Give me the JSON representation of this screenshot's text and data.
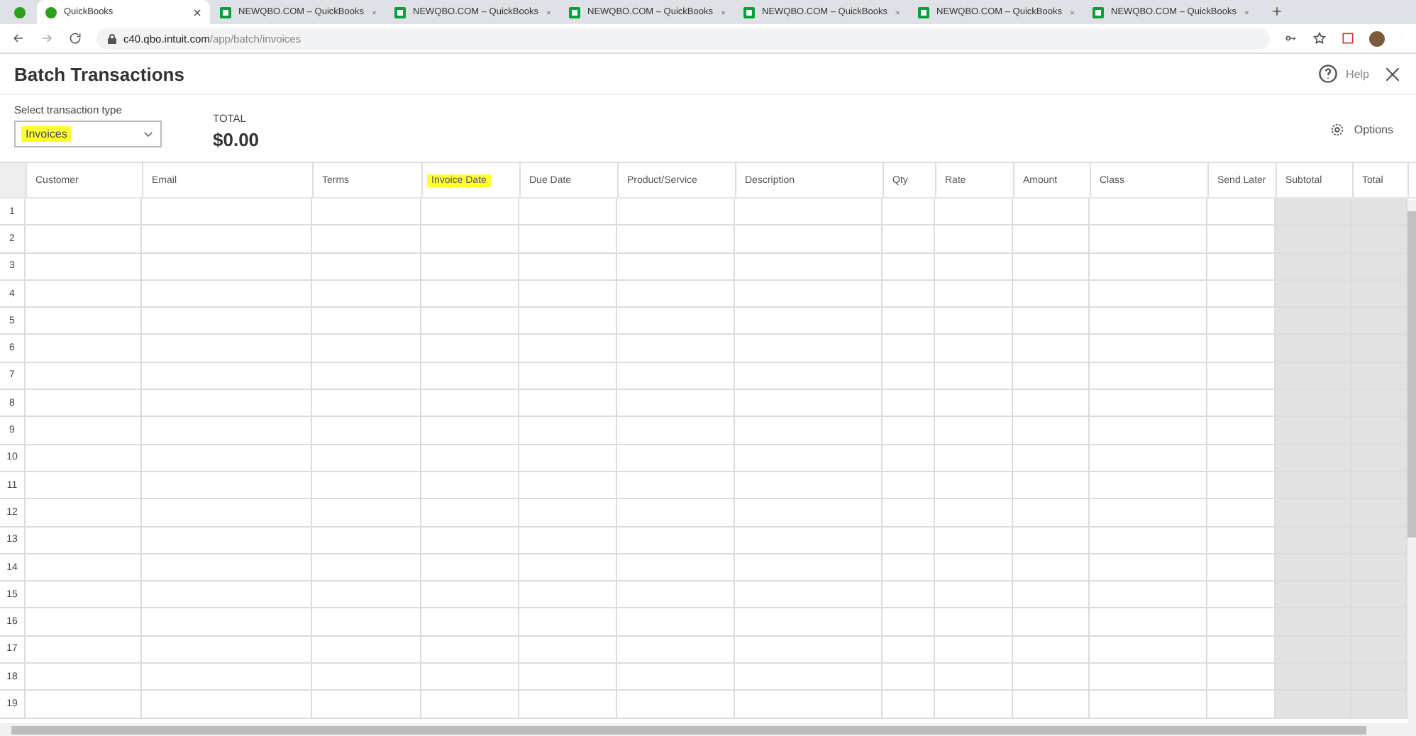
{
  "browser": {
    "tabs": [
      {
        "title": "QuickBooks",
        "selected": true,
        "kind": "qb"
      },
      {
        "title": "NEWQBO.COM – QuickBooks",
        "selected": false,
        "kind": "newqbo"
      },
      {
        "title": "NEWQBO.COM – QuickBooks",
        "selected": false,
        "kind": "newqbo"
      },
      {
        "title": "NEWQBO.COM – QuickBooks",
        "selected": false,
        "kind": "newqbo"
      },
      {
        "title": "NEWQBO.COM – QuickBooks",
        "selected": false,
        "kind": "newqbo"
      },
      {
        "title": "NEWQBO.COM – QuickBooks",
        "selected": false,
        "kind": "newqbo"
      },
      {
        "title": "NEWQBO.COM – QuickBooks",
        "selected": false,
        "kind": "newqbo"
      }
    ],
    "address": {
      "host": "c40.qbo.intuit.com",
      "path": "/app/batch/invoices"
    }
  },
  "page": {
    "title": "Batch Transactions",
    "help": "Help",
    "options": "Options"
  },
  "type_select": {
    "label": "Select transaction type",
    "value": "Invoices",
    "highlighted": true
  },
  "total": {
    "label": "TOTAL",
    "value": "$0.00"
  },
  "table": {
    "columns": [
      {
        "label": "Customer",
        "highlighted": false,
        "shaded": false
      },
      {
        "label": "Email",
        "highlighted": false,
        "shaded": false
      },
      {
        "label": "Terms",
        "highlighted": false,
        "shaded": false
      },
      {
        "label": "Invoice Date",
        "highlighted": true,
        "shaded": false
      },
      {
        "label": "Due Date",
        "highlighted": false,
        "shaded": false
      },
      {
        "label": "Product/Service",
        "highlighted": false,
        "shaded": false
      },
      {
        "label": "Description",
        "highlighted": false,
        "shaded": false
      },
      {
        "label": "Qty",
        "highlighted": false,
        "shaded": false
      },
      {
        "label": "Rate",
        "highlighted": false,
        "shaded": false
      },
      {
        "label": "Amount",
        "highlighted": false,
        "shaded": false
      },
      {
        "label": "Class",
        "highlighted": false,
        "shaded": false
      },
      {
        "label": "Send Later",
        "highlighted": false,
        "shaded": false
      },
      {
        "label": "Subtotal",
        "highlighted": false,
        "shaded": true
      },
      {
        "label": "Total",
        "highlighted": false,
        "shaded": true
      }
    ],
    "rows": [
      "1",
      "2",
      "3",
      "4",
      "5",
      "6",
      "7",
      "8",
      "9",
      "10",
      "11",
      "12",
      "13",
      "14",
      "15",
      "16",
      "17",
      "18",
      "19"
    ]
  }
}
